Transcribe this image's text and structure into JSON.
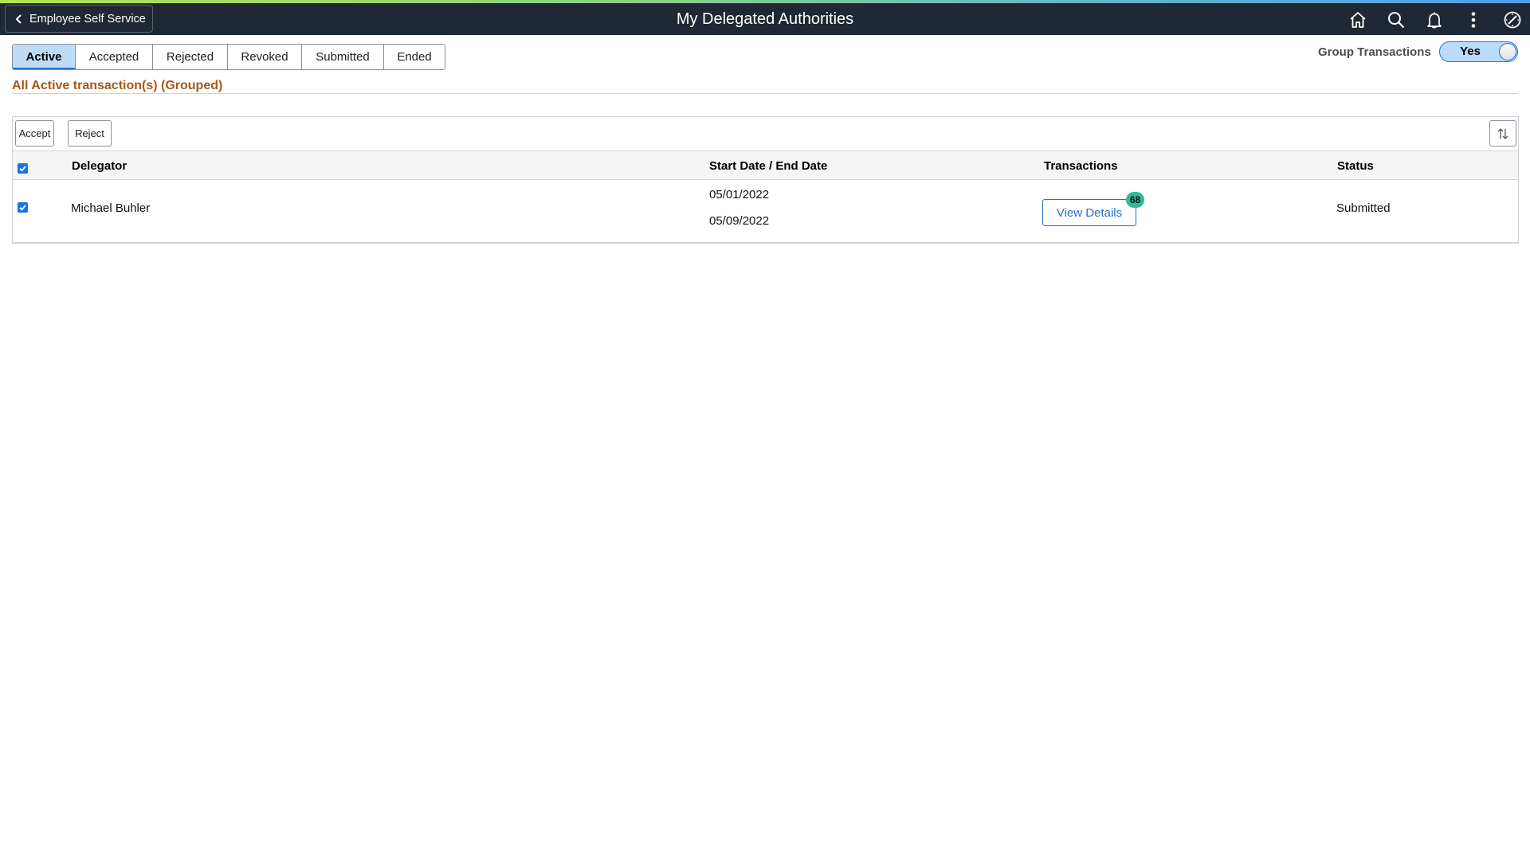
{
  "header": {
    "back_label": "Employee Self Service",
    "title": "My Delegated Authorities",
    "icons": [
      "home-icon",
      "search-icon",
      "bell-icon",
      "more-vertical-icon",
      "compass-icon"
    ]
  },
  "tabs": [
    {
      "label": "Active",
      "active": true
    },
    {
      "label": "Accepted",
      "active": false
    },
    {
      "label": "Rejected",
      "active": false
    },
    {
      "label": "Revoked",
      "active": false
    },
    {
      "label": "Submitted",
      "active": false
    },
    {
      "label": "Ended",
      "active": false
    }
  ],
  "group_transactions": {
    "label": "Group Transactions",
    "value": "Yes"
  },
  "subtitle": "All Active transaction(s) (Grouped)",
  "grid": {
    "toolbar": {
      "accept_label": "Accept",
      "reject_label": "Reject",
      "sort_icon": "sort-icon"
    },
    "columns": [
      "Delegator",
      "Start Date / End Date",
      "Transactions",
      "Status"
    ],
    "select_all_checked": true,
    "rows": [
      {
        "checked": true,
        "delegator": "Michael Buhler",
        "start_date": "05/01/2022",
        "end_date": "05/09/2022",
        "transactions_button": "View Details",
        "transactions_count": "68",
        "status": "Submitted"
      }
    ]
  },
  "colors": {
    "accent": "#2a6fc9",
    "header_bg": "#1f2834",
    "subtitle": "#a5581b",
    "badge": "#2fba9a",
    "active_tab": "#bfdcf7"
  }
}
